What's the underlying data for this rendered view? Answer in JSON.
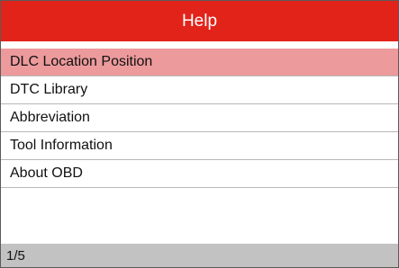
{
  "header": {
    "title": "Help",
    "accent_color": "#e2231a"
  },
  "menu": {
    "selected_index": 0,
    "selected_color": "#ec9a9c",
    "items": [
      {
        "label": "DLC Location Position"
      },
      {
        "label": "DTC Library"
      },
      {
        "label": "Abbreviation"
      },
      {
        "label": "Tool Information"
      },
      {
        "label": "About OBD"
      }
    ]
  },
  "status": {
    "page_indicator": "1/5"
  }
}
